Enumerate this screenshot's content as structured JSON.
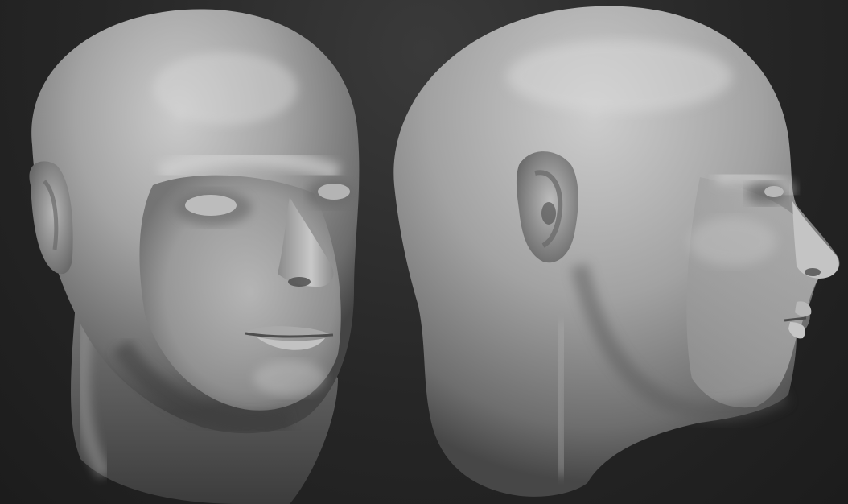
{
  "scene": {
    "background_color": "#262626",
    "clay_base_color": "#8e8e8e",
    "clay_highlight_color": "#cfcfcf",
    "clay_shadow_color": "#3a3a3a"
  },
  "models": [
    {
      "view": "three-quarter",
      "icon": "sculpted-head-front-view"
    },
    {
      "view": "profile",
      "icon": "sculpted-head-side-view"
    }
  ]
}
